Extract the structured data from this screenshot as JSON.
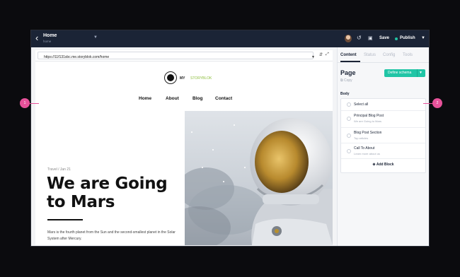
{
  "topbar": {
    "back_icon": "arrow-left-icon",
    "title": "Home",
    "subtitle": "home",
    "save_label": "Save",
    "publish_label": "Publish"
  },
  "preview": {
    "url": "https://11f131sbc.me.storyblok.com/home",
    "logo_text_a": "MY",
    "logo_text_b": "STORYBLOK",
    "nav": [
      "Home",
      "About",
      "Blog",
      "Contact"
    ],
    "meta": "Travel / Jan 21",
    "headline": "We are Going to Mars",
    "paragraph": "Mars is the fourth planet from the Sun and the second-smallest planet in the Solar System after Mercury."
  },
  "panel": {
    "tabs": [
      "Content",
      "Status",
      "Config",
      "Tools"
    ],
    "page_title": "Page",
    "copy_label": "Copy",
    "define_schema": "Define schema",
    "body_label": "Body",
    "items": [
      {
        "label": "Select all",
        "sub": ""
      },
      {
        "label": "Principal Blog Post",
        "sub": "We are Going to Mars"
      },
      {
        "label": "Blog Post Section",
        "sub": "Top articles"
      },
      {
        "label": "Call To About",
        "sub": "Learn more about us"
      }
    ],
    "add_block": "Add Block"
  },
  "markers": [
    "1",
    "2"
  ],
  "colors": {
    "accent": "#20c5a6",
    "topbar": "#1b2436",
    "marker": "#e7529a"
  }
}
